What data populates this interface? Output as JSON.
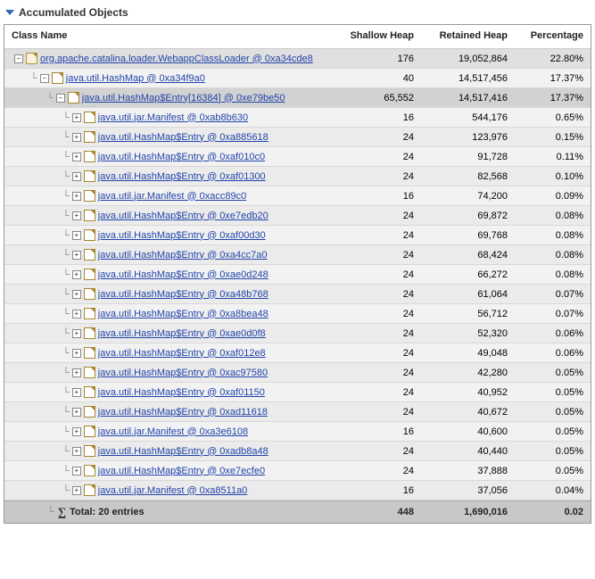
{
  "section": {
    "title": "Accumulated Objects"
  },
  "headers": {
    "className": "Class Name",
    "shallow": "Shallow Heap",
    "retained": "Retained Heap",
    "percentage": "Percentage"
  },
  "rows": [
    {
      "level": 0,
      "expanded": true,
      "hl": 1,
      "label": "org.apache.catalina.loader.WebappClassLoader @ 0xa34cde8",
      "shallow": "176",
      "retained": "19,052,864",
      "pct": "22.80%"
    },
    {
      "level": 1,
      "expanded": true,
      "hl": 0,
      "label": "java.util.HashMap @ 0xa34f9a0",
      "shallow": "40",
      "retained": "14,517,456",
      "pct": "17.37%"
    },
    {
      "level": 2,
      "expanded": true,
      "hl": 2,
      "label": "java.util.HashMap$Entry[16384] @ 0xe79be50",
      "shallow": "65,552",
      "retained": "14,517,416",
      "pct": "17.37%"
    },
    {
      "level": 3,
      "expanded": false,
      "alt": 0,
      "label": "java.util.jar.Manifest @ 0xab8b630",
      "shallow": "16",
      "retained": "544,176",
      "pct": "0.65%"
    },
    {
      "level": 3,
      "expanded": false,
      "alt": 1,
      "label": "java.util.HashMap$Entry @ 0xa885618",
      "shallow": "24",
      "retained": "123,976",
      "pct": "0.15%"
    },
    {
      "level": 3,
      "expanded": false,
      "alt": 0,
      "label": "java.util.HashMap$Entry @ 0xaf010c0",
      "shallow": "24",
      "retained": "91,728",
      "pct": "0.11%"
    },
    {
      "level": 3,
      "expanded": false,
      "alt": 1,
      "label": "java.util.HashMap$Entry @ 0xaf01300",
      "shallow": "24",
      "retained": "82,568",
      "pct": "0.10%"
    },
    {
      "level": 3,
      "expanded": false,
      "alt": 0,
      "label": "java.util.jar.Manifest @ 0xacc89c0",
      "shallow": "16",
      "retained": "74,200",
      "pct": "0.09%"
    },
    {
      "level": 3,
      "expanded": false,
      "alt": 1,
      "label": "java.util.HashMap$Entry @ 0xe7edb20",
      "shallow": "24",
      "retained": "69,872",
      "pct": "0.08%"
    },
    {
      "level": 3,
      "expanded": false,
      "alt": 0,
      "label": "java.util.HashMap$Entry @ 0xaf00d30",
      "shallow": "24",
      "retained": "69,768",
      "pct": "0.08%"
    },
    {
      "level": 3,
      "expanded": false,
      "alt": 1,
      "label": "java.util.HashMap$Entry @ 0xa4cc7a0",
      "shallow": "24",
      "retained": "68,424",
      "pct": "0.08%"
    },
    {
      "level": 3,
      "expanded": false,
      "alt": 0,
      "label": "java.util.HashMap$Entry @ 0xae0d248",
      "shallow": "24",
      "retained": "66,272",
      "pct": "0.08%"
    },
    {
      "level": 3,
      "expanded": false,
      "alt": 1,
      "label": "java.util.HashMap$Entry @ 0xa48b768",
      "shallow": "24",
      "retained": "61,064",
      "pct": "0.07%"
    },
    {
      "level": 3,
      "expanded": false,
      "alt": 0,
      "label": "java.util.HashMap$Entry @ 0xa8bea48",
      "shallow": "24",
      "retained": "56,712",
      "pct": "0.07%"
    },
    {
      "level": 3,
      "expanded": false,
      "alt": 1,
      "label": "java.util.HashMap$Entry @ 0xae0d0f8",
      "shallow": "24",
      "retained": "52,320",
      "pct": "0.06%"
    },
    {
      "level": 3,
      "expanded": false,
      "alt": 0,
      "label": "java.util.HashMap$Entry @ 0xaf012e8",
      "shallow": "24",
      "retained": "49,048",
      "pct": "0.06%"
    },
    {
      "level": 3,
      "expanded": false,
      "alt": 1,
      "label": "java.util.HashMap$Entry @ 0xac97580",
      "shallow": "24",
      "retained": "42,280",
      "pct": "0.05%"
    },
    {
      "level": 3,
      "expanded": false,
      "alt": 0,
      "label": "java.util.HashMap$Entry @ 0xaf01150",
      "shallow": "24",
      "retained": "40,952",
      "pct": "0.05%"
    },
    {
      "level": 3,
      "expanded": false,
      "alt": 1,
      "label": "java.util.HashMap$Entry @ 0xad11618",
      "shallow": "24",
      "retained": "40,672",
      "pct": "0.05%"
    },
    {
      "level": 3,
      "expanded": false,
      "alt": 0,
      "label": "java.util.jar.Manifest @ 0xa3e6108",
      "shallow": "16",
      "retained": "40,600",
      "pct": "0.05%"
    },
    {
      "level": 3,
      "expanded": false,
      "alt": 1,
      "label": "java.util.HashMap$Entry @ 0xadb8a48",
      "shallow": "24",
      "retained": "40,440",
      "pct": "0.05%"
    },
    {
      "level": 3,
      "expanded": false,
      "alt": 0,
      "label": "java.util.HashMap$Entry @ 0xe7ecfe0",
      "shallow": "24",
      "retained": "37,888",
      "pct": "0.05%"
    },
    {
      "level": 3,
      "expanded": false,
      "alt": 1,
      "label": "java.util.jar.Manifest @ 0xa8511a0",
      "shallow": "16",
      "retained": "37,056",
      "pct": "0.04%"
    }
  ],
  "total": {
    "label": "Total: 20 entries",
    "shallow": "448",
    "retained": "1,690,016",
    "pct": "0.02"
  }
}
